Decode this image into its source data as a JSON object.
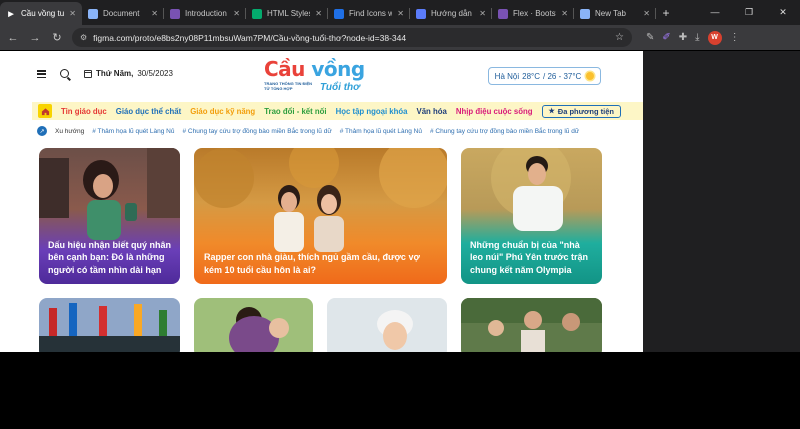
{
  "browser": {
    "tabs": [
      {
        "label": "Cầu vồng tuổ",
        "favicon": "play-icon",
        "color": "#ffffff",
        "active": true
      },
      {
        "label": "Document",
        "favicon": "globe-icon",
        "color": "#8ab4f8",
        "active": false
      },
      {
        "label": "Introduction",
        "favicon": "bootstrap-icon",
        "color": "#7952b3",
        "active": false
      },
      {
        "label": "HTML Styles",
        "favicon": "w3-icon",
        "color": "#04aa6d",
        "active": false
      },
      {
        "label": "Find Icons w",
        "favicon": "flag-icon",
        "color": "#1f6fe5",
        "active": false
      },
      {
        "label": "Hướng dẫn",
        "favicon": "v-icon",
        "color": "#5b7cfa",
        "active": false
      },
      {
        "label": "Flex · Bootst",
        "favicon": "bootstrap-icon",
        "color": "#7952b3",
        "active": false
      },
      {
        "label": "New Tab",
        "favicon": "chrome-icon",
        "color": "#8ab4f8",
        "active": false
      }
    ],
    "url": "figma.com/proto/e8bs2ny08P11mbsuWam7PM/Cầu-vồng-tuổi-thơ?node-id=38-344",
    "profile_initial": "W"
  },
  "site": {
    "date_label": "Thứ Năm,",
    "date_value": "30/5/2023",
    "logo": {
      "part1": "Cầu",
      "part2": "vồng",
      "subtitle": "Trang thông tin điện tử tổng hợp",
      "tail": "Tuổi thơ"
    },
    "weather": {
      "city": "Hà Nội",
      "now": "28°C",
      "range": "/ 26 - 37°C"
    },
    "categories": [
      {
        "label": "Tin giáo dục",
        "color": "#e53935"
      },
      {
        "label": "Giáo dục thể chất",
        "color": "#1f6fb8"
      },
      {
        "label": "Giáo dục kỹ năng",
        "color": "#f29e0c"
      },
      {
        "label": "Trao đổi - kết nối",
        "color": "#2e9e3e"
      },
      {
        "label": "Học tập ngoại khóa",
        "color": "#1f8fd0"
      },
      {
        "label": "Văn hóa",
        "color": "#1f3f7a"
      },
      {
        "label": "Nhịp điệu cuộc sống",
        "color": "#d81b7a"
      }
    ],
    "media_button": "Đa phương tiện",
    "trend_label": "Xu hướng",
    "trends": [
      "# Thảm họa lũ quét Làng Nủ",
      "# Chung tay cứu trợ đồng bào miền Bắc trong lũ dữ",
      "# Thảm họa lũ quét Làng Nủ",
      "# Chung tay cứu trợ đồng bào miền Bắc trong lũ dữ"
    ],
    "featured": [
      {
        "title": "Dấu hiệu nhận biết quý nhân bên cạnh bạn: Đó là những người có tầm nhìn dài hạn",
        "accent": "#6a3fb8"
      },
      {
        "title": "Rapper con nhà giàu, thích ngủ gầm cầu, được vợ kém 10 tuổi cầu hôn là ai?",
        "accent": "#f07a1a"
      },
      {
        "title": "Những chuẩn bị của \"nhà leo núi\" Phú Yên trước trận chung kết năm Olympia",
        "accent": "#1aa398"
      }
    ]
  }
}
